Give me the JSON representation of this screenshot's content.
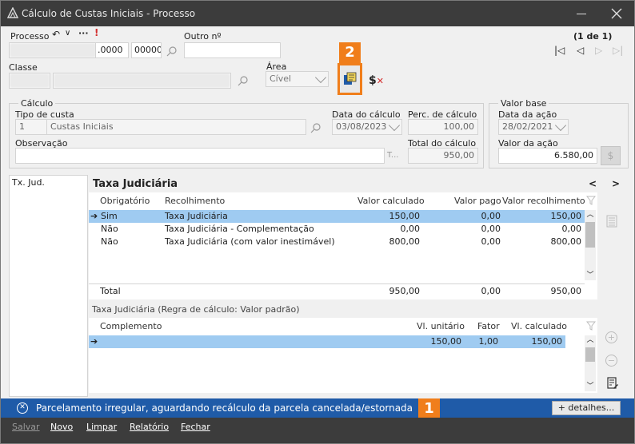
{
  "window": {
    "title": "Cálculo de Custas Iniciais - Processo",
    "status_message": "Parcelamento irregular, aguardando recálculo da parcela cancelada/estornada",
    "details_button": "+ detalhes...",
    "badge1": "1",
    "badge2": "2"
  },
  "header": {
    "processo_label": "Processo",
    "processo_value": ".0000",
    "processo_seq": "00000",
    "outro_label": "Outro nº",
    "page_indicator": "(1 de 1)",
    "classe_label": "Classe",
    "area_label": "Área",
    "area_value": "Cível"
  },
  "calculo": {
    "group_label": "Cálculo",
    "tipo_label": "Tipo de custa",
    "tipo_code": "1",
    "tipo_desc": "Custas Iniciais",
    "data_calc_label": "Data do cálculo",
    "data_calc_value": "03/08/2023",
    "perc_label": "Perc. de cálculo",
    "perc_value": "100,00",
    "obs_label": "Observação",
    "obs_placeholder": "T...",
    "total_label": "Total do cálculo",
    "total_value": "950,00"
  },
  "valor_base": {
    "group_label": "Valor base",
    "data_acao_label": "Data da ação",
    "data_acao_value": "28/02/2021",
    "valor_acao_label": "Valor da ação",
    "valor_acao_value": "6.580,00"
  },
  "left_list": {
    "items": [
      "Tx. Jud."
    ]
  },
  "taxa": {
    "title": "Taxa Judiciária",
    "nav_prev": "<",
    "nav_next": ">",
    "columns": [
      "Obrigatório",
      "Recolhimento",
      "Valor calculado",
      "Valor pago",
      "Valor recolhimento"
    ],
    "rows": [
      {
        "obrig": "Sim",
        "recolhimento": "Taxa Judiciária",
        "calc": "150,00",
        "pago": "0,00",
        "recol": "150,00"
      },
      {
        "obrig": "Não",
        "recolhimento": "Taxa Judiciária - Complementação",
        "calc": "0,00",
        "pago": "0,00",
        "recol": "0,00"
      },
      {
        "obrig": "Não",
        "recolhimento": "Taxa Judiciária (com valor inestimável)",
        "calc": "800,00",
        "pago": "0,00",
        "recol": "800,00"
      }
    ],
    "total_label": "Total",
    "total_calc": "950,00",
    "total_pago": "0,00",
    "total_recol": "950,00",
    "regra_label": "Taxa Judiciária (Regra de cálculo: Valor padrão)",
    "sub_columns": [
      "Complemento",
      "Vl. unitário",
      "Fator",
      "Vl. calculado"
    ],
    "sub_rows": [
      {
        "complemento": "",
        "unit": "150,00",
        "fator": "1,00",
        "calc": "150,00"
      }
    ]
  },
  "buttons": {
    "salvar": "Salvar",
    "novo": "Novo",
    "limpar": "Limpar",
    "relatorio": "Relatório",
    "fechar": "Fechar"
  },
  "colors": {
    "titlebar": "#3c3c3c",
    "status_bar": "#1f5ba8",
    "selection": "#9fcbf1",
    "badge": "#f07e1b"
  }
}
